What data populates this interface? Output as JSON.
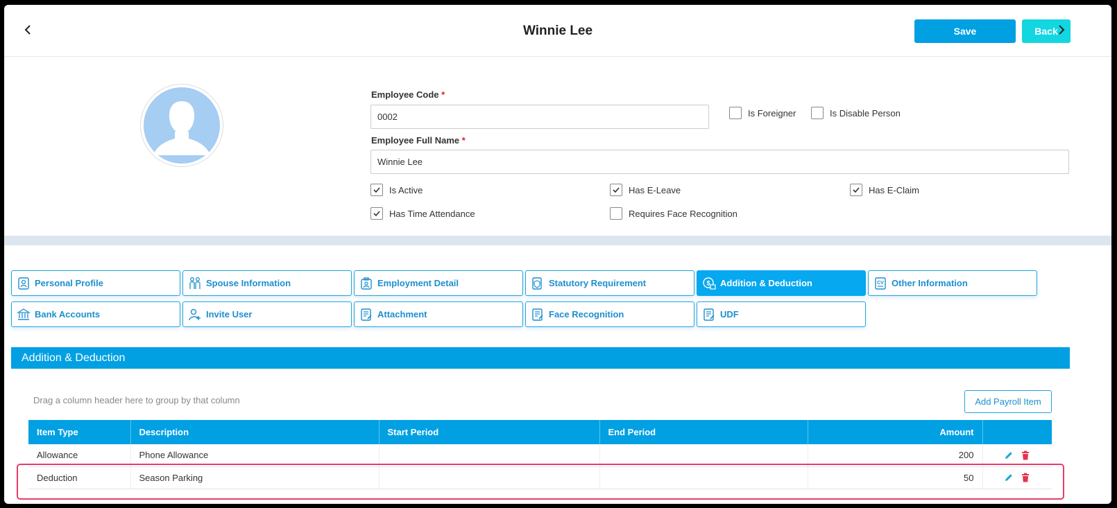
{
  "header": {
    "title": "Winnie Lee",
    "save_label": "Save",
    "back_label": "Back"
  },
  "profile": {
    "employee_code_label": "Employee Code",
    "employee_code_value": "0002",
    "full_name_label": "Employee Full Name",
    "full_name_value": "Winnie Lee",
    "required_mark": "*",
    "checkboxes": {
      "is_foreigner": {
        "label": "Is Foreigner",
        "checked": false
      },
      "is_disable_person": {
        "label": "Is Disable Person",
        "checked": false
      },
      "is_active": {
        "label": "Is Active",
        "checked": true
      },
      "has_e_leave": {
        "label": "Has E-Leave",
        "checked": true
      },
      "has_e_claim": {
        "label": "Has E-Claim",
        "checked": true
      },
      "has_time_attendance": {
        "label": "Has Time Attendance",
        "checked": true
      },
      "requires_face_recognition": {
        "label": "Requires Face Recognition",
        "checked": false
      }
    }
  },
  "tabs": [
    {
      "label": "Personal Profile",
      "icon": "id-card-icon"
    },
    {
      "label": "Spouse Information",
      "icon": "couple-icon"
    },
    {
      "label": "Employment Detail",
      "icon": "briefcase-icon"
    },
    {
      "label": "Statutory Requirement",
      "icon": "shield-document-icon"
    },
    {
      "label": "Addition & Deduction",
      "icon": "money-icon",
      "active": true
    },
    {
      "label": "Other Information",
      "icon": "cv-icon"
    },
    {
      "label": "Bank Accounts",
      "icon": "bank-icon"
    },
    {
      "label": "Invite User",
      "icon": "add-user-icon"
    },
    {
      "label": "Attachment",
      "icon": "document-edit-icon"
    },
    {
      "label": "Face Recognition",
      "icon": "document-edit-icon"
    },
    {
      "label": "UDF",
      "icon": "document-edit-icon"
    }
  ],
  "section": {
    "title": "Addition & Deduction",
    "group_hint": "Drag a column header here to group by that column",
    "add_button_label": "Add Payroll Item"
  },
  "grid": {
    "columns": [
      "Item Type",
      "Description",
      "Start Period",
      "End Period",
      "Amount"
    ],
    "rows": [
      {
        "item_type": "Allowance",
        "description": "Phone Allowance",
        "start_period": "",
        "end_period": "",
        "amount": "200"
      },
      {
        "item_type": "Deduction",
        "description": "Season Parking",
        "start_period": "",
        "end_period": "",
        "amount": "50"
      }
    ]
  },
  "colors": {
    "accent": "#00a0e3",
    "back_button": "#12d6e0",
    "delete_icon": "#e8304f",
    "highlight": "#e83a6a"
  }
}
